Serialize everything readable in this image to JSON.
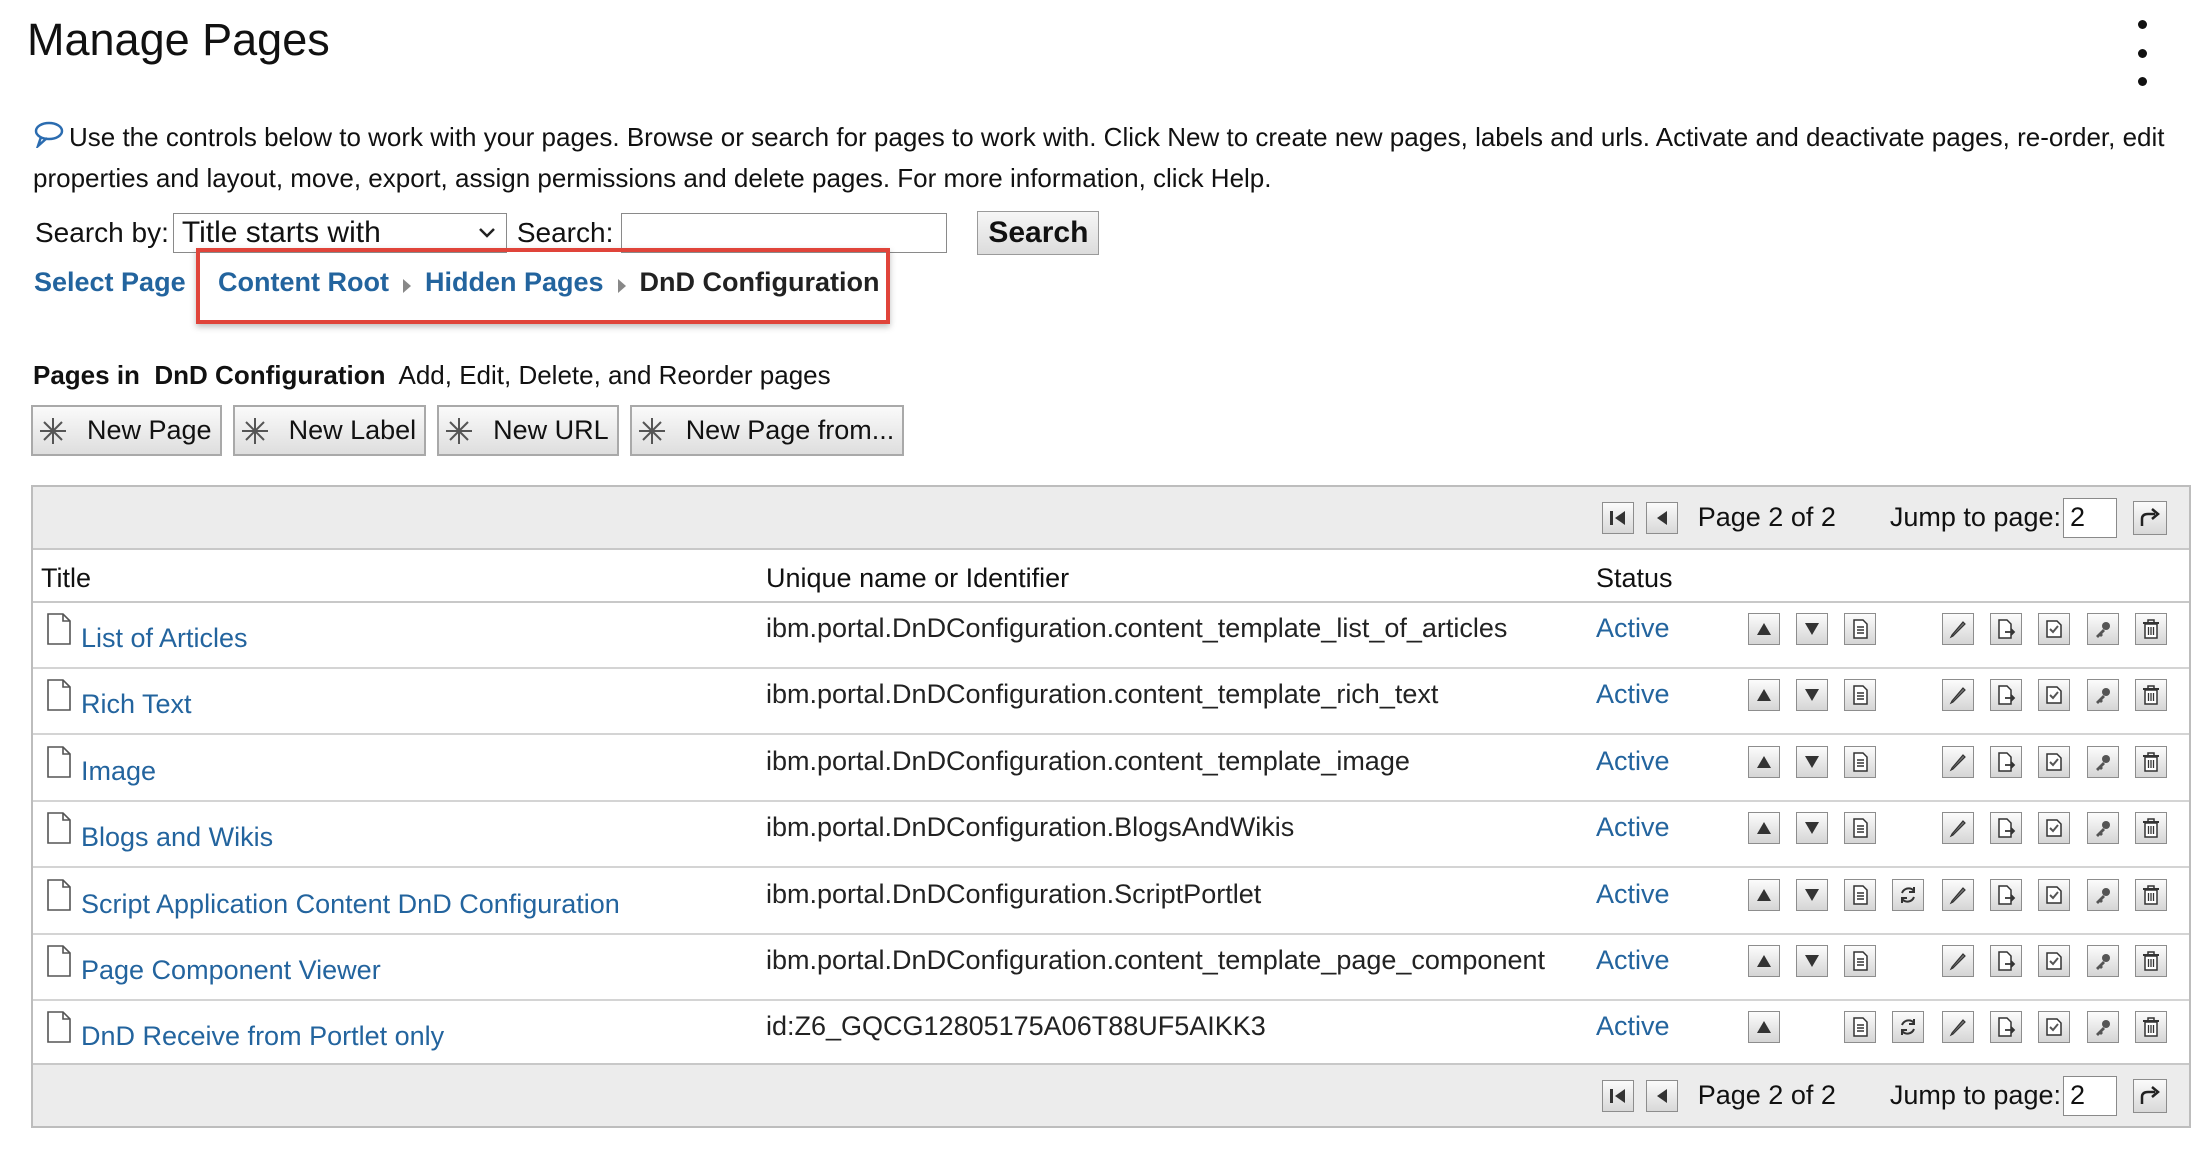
{
  "header": {
    "title": "Manage Pages",
    "menu_icon": "more-vertical-icon"
  },
  "description": {
    "icon": "help-bubble-icon",
    "text": "Use the controls below to work with your pages. Browse or search for pages to work with. Click New to create new pages, labels and urls. Activate and deactivate pages, re-order, edit properties and layout, move, export, assign permissions and delete pages. For more information, click Help."
  },
  "search": {
    "by_label": "Search by:",
    "by_value": "Title starts with",
    "label": "Search:",
    "value": "",
    "button": "Search"
  },
  "breadcrumb": {
    "select_page": "Select Page",
    "items": [
      "Content Root",
      "Hidden Pages"
    ],
    "current": "DnD Configuration",
    "highlight_color": "#e0443a"
  },
  "pages_in": {
    "prefix": "Pages in",
    "name": "DnD Configuration",
    "suffix": "Add, Edit, Delete, and Reorder pages"
  },
  "new_buttons": [
    "New Page",
    "New Label",
    "New URL",
    "New Page from..."
  ],
  "pager": {
    "label": "Page 2 of 2",
    "jump_label": "Jump to page:",
    "jump_value": "2"
  },
  "table": {
    "columns": [
      "Title",
      "Unique name or Identifier",
      "Status"
    ],
    "rows": [
      {
        "title": "List of Articles",
        "id": "ibm.portal.DnDConfiguration.content_template_list_of_articles",
        "status": "Active",
        "actions": [
          "move-up",
          "move-down",
          "properties",
          "edit",
          "export",
          "activate",
          "permissions",
          "delete"
        ]
      },
      {
        "title": "Rich Text",
        "id": "ibm.portal.DnDConfiguration.content_template_rich_text",
        "status": "Active",
        "actions": [
          "move-up",
          "move-down",
          "properties",
          "edit",
          "export",
          "activate",
          "permissions",
          "delete"
        ]
      },
      {
        "title": "Image",
        "id": "ibm.portal.DnDConfiguration.content_template_image",
        "status": "Active",
        "actions": [
          "move-up",
          "move-down",
          "properties",
          "edit",
          "export",
          "activate",
          "permissions",
          "delete"
        ]
      },
      {
        "title": "Blogs and Wikis",
        "id": "ibm.portal.DnDConfiguration.BlogsAndWikis",
        "status": "Active",
        "actions": [
          "move-up",
          "move-down",
          "properties",
          "edit",
          "export",
          "activate",
          "permissions",
          "delete"
        ]
      },
      {
        "title": "Script Application Content DnD Configuration",
        "id": "ibm.portal.DnDConfiguration.ScriptPortlet",
        "status": "Active",
        "actions": [
          "move-up",
          "move-down",
          "properties",
          "move-page",
          "edit",
          "export",
          "activate",
          "permissions",
          "delete"
        ]
      },
      {
        "title": "Page Component Viewer",
        "id": "ibm.portal.DnDConfiguration.content_template_page_component",
        "status": "Active",
        "actions": [
          "move-up",
          "move-down",
          "properties",
          "edit",
          "export",
          "activate",
          "permissions",
          "delete"
        ]
      },
      {
        "title": "DnD Receive from Portlet only",
        "id": "id:Z6_GQCG12805175A06T88UF5AIKK3",
        "status": "Active",
        "actions": [
          "move-up",
          "properties",
          "move-page",
          "edit",
          "export",
          "activate",
          "permissions",
          "delete"
        ]
      }
    ]
  },
  "colors": {
    "link": "#23649e",
    "pager_bg": "#ececec"
  }
}
